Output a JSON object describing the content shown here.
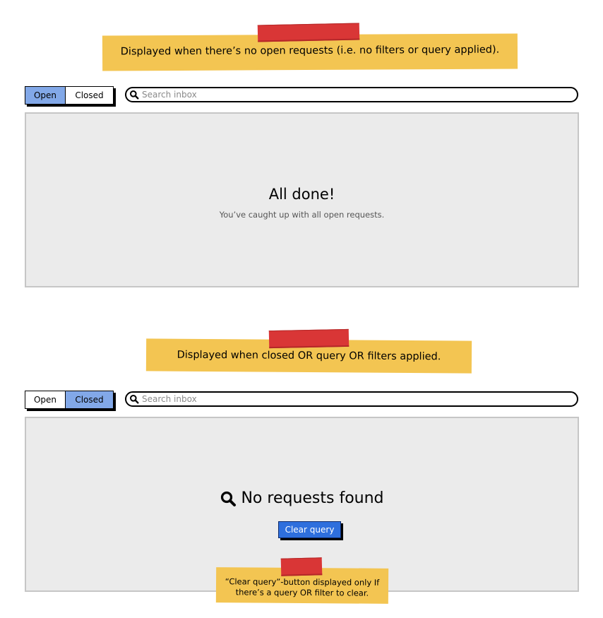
{
  "annotations": {
    "empty_state_note": "Displayed when there’s no open requests (i.e. no filters or query applied).",
    "no_results_note": "Displayed when closed OR query OR filters applied.",
    "clear_query_note_line1": "“Clear query”-button displayed only If",
    "clear_query_note_line2": "there’s a query OR filter to clear."
  },
  "state_all_done": {
    "tabs": [
      {
        "label": "Open",
        "active": true
      },
      {
        "label": "Closed",
        "active": false
      }
    ],
    "search": {
      "placeholder": "Search inbox",
      "value": ""
    },
    "title": "All done!",
    "subtitle": "You’ve caught up with all open requests."
  },
  "state_no_results": {
    "tabs": [
      {
        "label": "Open",
        "active": false
      },
      {
        "label": "Closed",
        "active": true
      }
    ],
    "search": {
      "placeholder": "Search inbox",
      "value": ""
    },
    "title": "No requests found",
    "clear_button": "Clear query"
  },
  "colors": {
    "note": "#f3c552",
    "tape": "#d93636",
    "active_tab": "#82a8e8",
    "panel": "#ebebeb",
    "primary_button": "#2e6fdd"
  },
  "icons": {
    "search": "magnifier-icon",
    "no_results": "magnifier-icon"
  }
}
